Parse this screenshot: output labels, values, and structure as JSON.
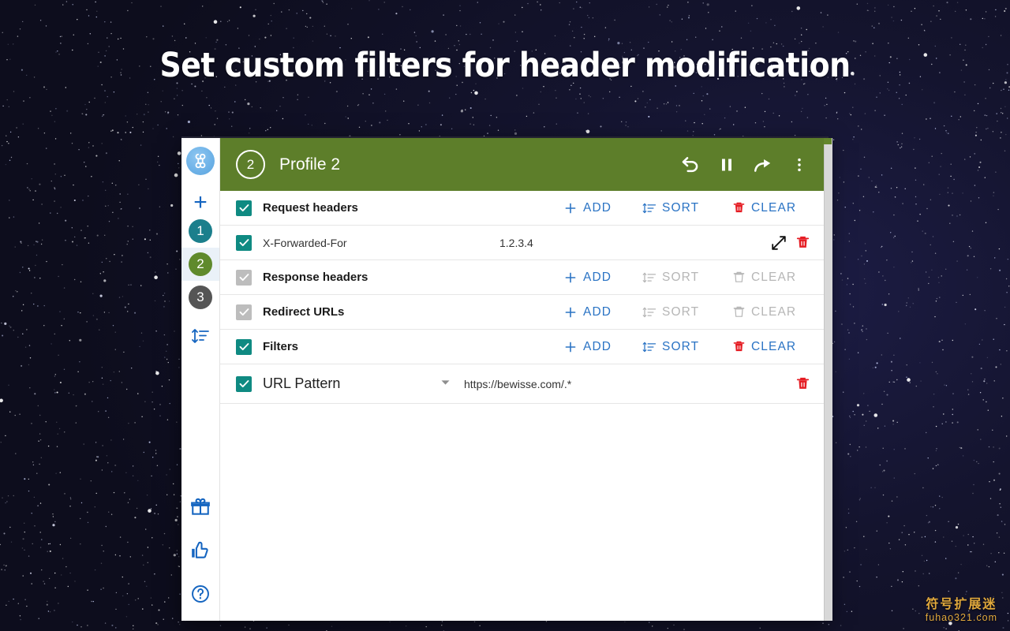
{
  "headline": "Set custom filters for header modification",
  "colors": {
    "header_green": "#5d7e2a",
    "accent_blue": "#2a73c4",
    "checkbox_on": "#0f8a82",
    "checkbox_off": "#bdbdbd",
    "delete_red": "#e51c23",
    "profile1": "#1b7f8c",
    "profile2": "#5f8a2c",
    "profile3": "#555555",
    "disabled_gray": "#b6b6b6"
  },
  "sidebar": {
    "logo_icon": "command-loop-icon",
    "add_profile_label": "+",
    "profiles": [
      {
        "label": "1",
        "color": "#1b7f8c",
        "selected": false,
        "name": "sidebar-profile-1"
      },
      {
        "label": "2",
        "color": "#5f8a2c",
        "selected": true,
        "name": "sidebar-profile-2"
      },
      {
        "label": "3",
        "color": "#555555",
        "selected": false,
        "name": "sidebar-profile-3"
      }
    ],
    "sort_icon": "sort-icon",
    "bottom_icons": [
      {
        "name": "gift-icon"
      },
      {
        "name": "thumbs-up-icon"
      },
      {
        "name": "help-icon"
      }
    ]
  },
  "titlebar": {
    "profile_number": "2",
    "profile_name": "Profile 2",
    "icons": [
      {
        "name": "undo-icon"
      },
      {
        "name": "pause-icon"
      },
      {
        "name": "redo-icon"
      },
      {
        "name": "more-vertical-icon"
      }
    ]
  },
  "actions": {
    "add": "ADD",
    "sort": "SORT",
    "clear": "CLEAR"
  },
  "sections": {
    "request_headers": {
      "label": "Request headers",
      "checked": true,
      "enabled": true,
      "rows": [
        {
          "checked": true,
          "name": "X-Forwarded-For",
          "value": "1.2.3.4"
        }
      ]
    },
    "response_headers": {
      "label": "Response headers",
      "checked": true,
      "enabled": false,
      "rows": []
    },
    "redirect_urls": {
      "label": "Redirect URLs",
      "checked": true,
      "enabled": false,
      "rows": []
    },
    "filters": {
      "label": "Filters",
      "checked": true,
      "enabled": true,
      "rows": [
        {
          "checked": true,
          "name": "URL Pattern",
          "value": "https://bewisse.com/.*"
        }
      ]
    }
  },
  "watermark": {
    "cn": "符号扩展迷",
    "en": "fuhao321.com"
  }
}
